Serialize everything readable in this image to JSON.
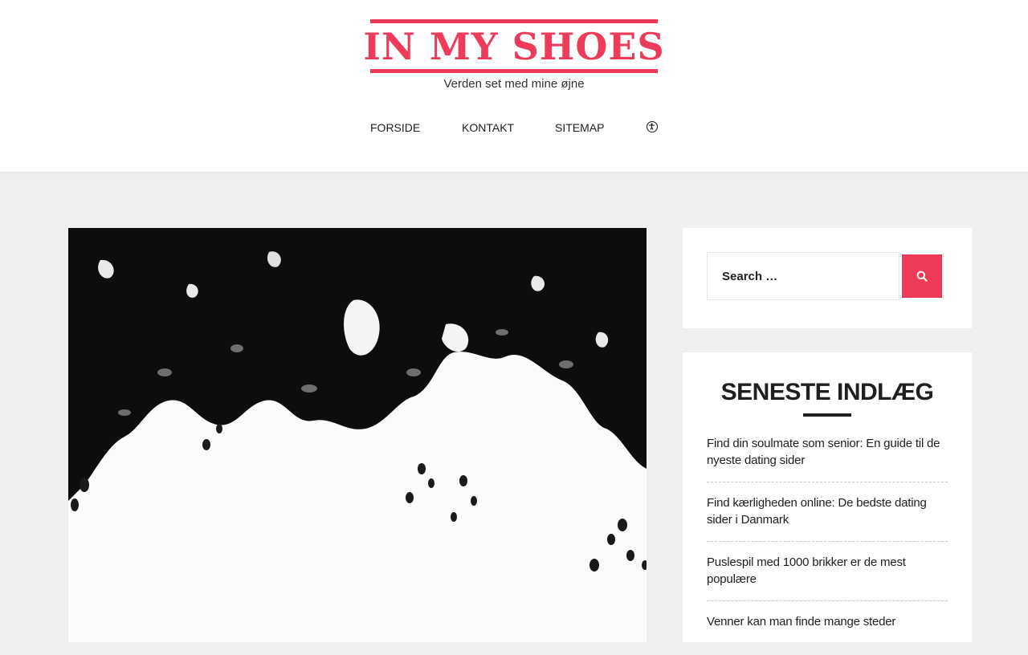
{
  "site": {
    "title": "IN MY SHOES",
    "tagline": "Verden set med mine øjne",
    "accent_color": "#ef3b5a"
  },
  "nav": {
    "items": [
      "FORSIDE",
      "KONTAKT",
      "SITEMAP"
    ],
    "accessibility_icon": "accessibility-icon"
  },
  "featured_image": {
    "description_icon": "tree-leaves-photo"
  },
  "search": {
    "placeholder": "Search …",
    "button_icon": "search-icon"
  },
  "recent_posts": {
    "title": "SENESTE INDLÆG",
    "items": [
      "Find din soulmate som senior: En guide til de nyeste dating sider",
      "Find kærligheden online: De bedste dating sider i Danmark",
      "Puslespil med 1000 brikker er de mest populære",
      "Venner kan man finde mange steder"
    ]
  }
}
